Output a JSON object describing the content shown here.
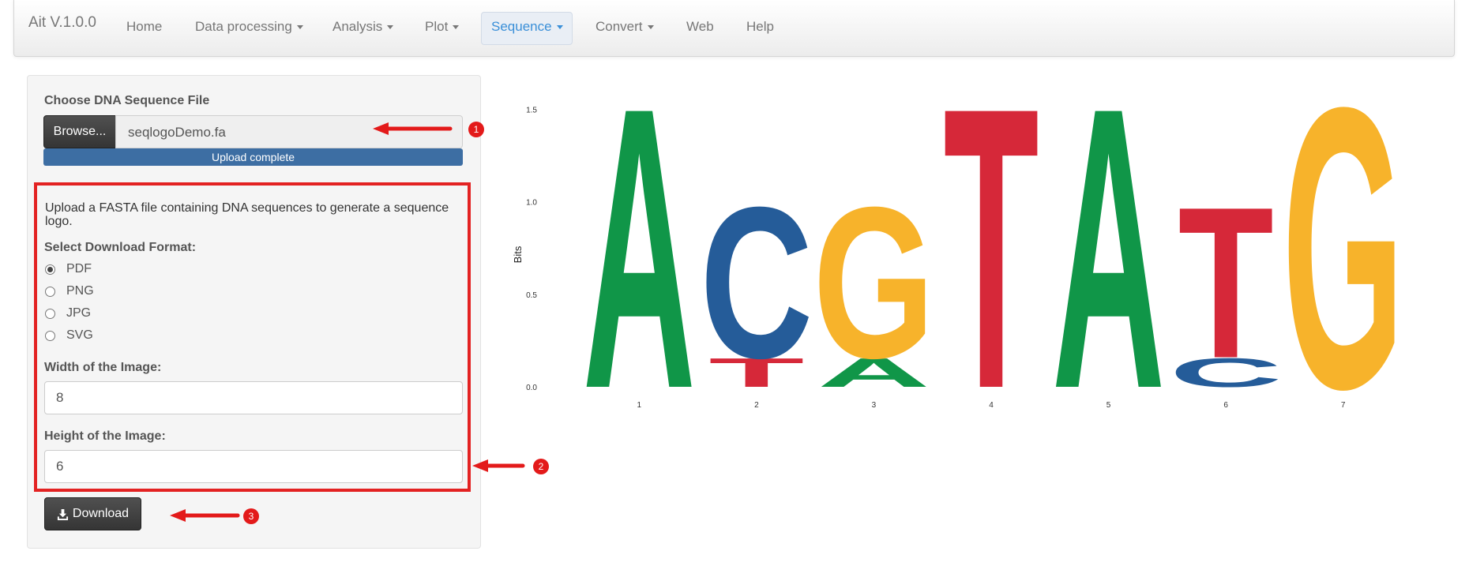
{
  "navbar": {
    "brand": "Ait V.1.0.0",
    "items": [
      {
        "label": "Home",
        "dropdown": false
      },
      {
        "label": "Data processing",
        "dropdown": true
      },
      {
        "label": "Analysis",
        "dropdown": true
      },
      {
        "label": "Plot",
        "dropdown": true
      },
      {
        "label": "Sequence",
        "dropdown": true,
        "active": true
      },
      {
        "label": "Convert",
        "dropdown": true
      },
      {
        "label": "Web",
        "dropdown": false
      },
      {
        "label": "Help",
        "dropdown": false
      }
    ],
    "active_color": "#3a8fd8"
  },
  "sidebar": {
    "file_label": "Choose DNA Sequence File",
    "browse_label": "Browse...",
    "file_name": "seqlogoDemo.fa",
    "upload_status": "Upload complete",
    "upload_progress": 1.0,
    "description": "Upload a FASTA file containing DNA sequences to generate a sequence logo.",
    "format_label": "Select Download Format:",
    "formats": [
      "PDF",
      "PNG",
      "JPG",
      "SVG"
    ],
    "selected_format": "PDF",
    "width_label": "Width of the Image:",
    "width_value": "8",
    "height_label": "Height of the Image:",
    "height_value": "6",
    "download_label": "Download"
  },
  "callouts": [
    "1",
    "2",
    "3"
  ],
  "chart_data": {
    "type": "sequence-logo",
    "ylabel": "Bits",
    "ylim": [
      0,
      1.6
    ],
    "y_ticks": [
      "0.0",
      "0.5",
      "1.0",
      "1.5"
    ],
    "positions": [
      "1",
      "2",
      "3",
      "4",
      "5",
      "6",
      "7"
    ],
    "stacks": [
      [
        {
          "base": "A",
          "bits": 1.56
        }
      ],
      [
        {
          "base": "T",
          "bits": 0.16
        },
        {
          "base": "C",
          "bits": 0.84
        }
      ],
      [
        {
          "base": "A",
          "bits": 0.16
        },
        {
          "base": "G",
          "bits": 0.84
        }
      ],
      [
        {
          "base": "T",
          "bits": 1.56
        }
      ],
      [
        {
          "base": "A",
          "bits": 1.56
        }
      ],
      [
        {
          "base": "C",
          "bits": 0.16
        },
        {
          "base": "T",
          "bits": 0.84
        }
      ],
      [
        {
          "base": "G",
          "bits": 1.56
        }
      ]
    ],
    "colors": {
      "A": "#109648",
      "C": "#255c99",
      "G": "#f7b32b",
      "T": "#d62839"
    }
  }
}
